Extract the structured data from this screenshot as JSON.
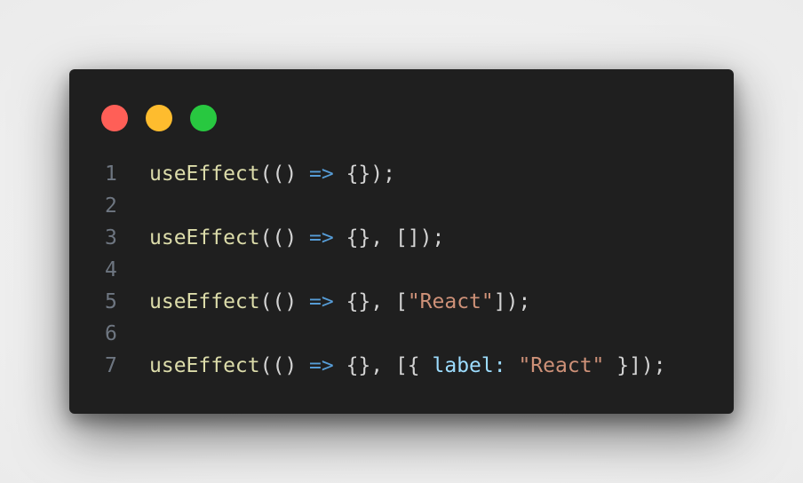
{
  "colors": {
    "window_bg": "#1f1f1f",
    "close": "#ff5f57",
    "minimize": "#febc2e",
    "zoom": "#28c840",
    "function": "#dcdcaa",
    "arrow": "#569cd6",
    "string": "#ce9178",
    "property": "#9cdcfe",
    "punctuation": "#d4d4d4",
    "line_number": "#6e7681"
  },
  "window_controls": [
    "close",
    "minimize",
    "zoom"
  ],
  "code_lines": [
    {
      "number": "1",
      "tokens": [
        {
          "text": "useEffect",
          "type": "fn"
        },
        {
          "text": "(() ",
          "type": "punc"
        },
        {
          "text": "=>",
          "type": "arrow"
        },
        {
          "text": " {});",
          "type": "punc"
        }
      ]
    },
    {
      "number": "2",
      "tokens": []
    },
    {
      "number": "3",
      "tokens": [
        {
          "text": "useEffect",
          "type": "fn"
        },
        {
          "text": "(() ",
          "type": "punc"
        },
        {
          "text": "=>",
          "type": "arrow"
        },
        {
          "text": " {}, []);",
          "type": "punc"
        }
      ]
    },
    {
      "number": "4",
      "tokens": []
    },
    {
      "number": "5",
      "tokens": [
        {
          "text": "useEffect",
          "type": "fn"
        },
        {
          "text": "(() ",
          "type": "punc"
        },
        {
          "text": "=>",
          "type": "arrow"
        },
        {
          "text": " {}, [",
          "type": "punc"
        },
        {
          "text": "\"React\"",
          "type": "str"
        },
        {
          "text": "]);",
          "type": "punc"
        }
      ]
    },
    {
      "number": "6",
      "tokens": []
    },
    {
      "number": "7",
      "tokens": [
        {
          "text": "useEffect",
          "type": "fn"
        },
        {
          "text": "(() ",
          "type": "punc"
        },
        {
          "text": "=>",
          "type": "arrow"
        },
        {
          "text": " {}, [{ ",
          "type": "punc"
        },
        {
          "text": "label",
          "type": "prop"
        },
        {
          "text": ": ",
          "type": "prop"
        },
        {
          "text": "\"React\"",
          "type": "str"
        },
        {
          "text": " }]);",
          "type": "punc"
        }
      ]
    }
  ]
}
